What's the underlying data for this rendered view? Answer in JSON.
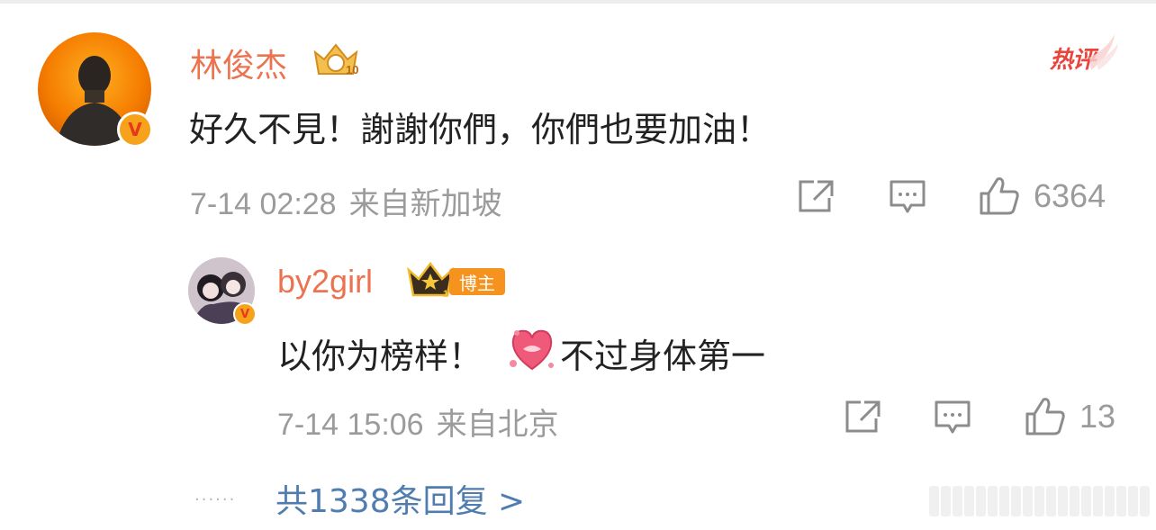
{
  "comment": {
    "author": "林俊杰",
    "text": "好久不見！謝謝你們，你們也要加油！",
    "date": "7-14 02:28",
    "location": "来自新加坡",
    "likes": "6364",
    "hot_label": "热评",
    "level_badge": "10"
  },
  "reply": {
    "author": "by2girl",
    "host_label": "博主",
    "text_before": "以你为榜样！",
    "text_after": "不过身体第一",
    "date": "7-14 15:06",
    "location": "来自北京",
    "likes": "13",
    "crown_badge": "1"
  },
  "more_replies": "共1338条回复 >",
  "colors": {
    "name": "#eb7350",
    "link": "#507daf",
    "meta": "#9b9b9b",
    "hot": "#e8453c",
    "host_tag": "#f6921e"
  }
}
